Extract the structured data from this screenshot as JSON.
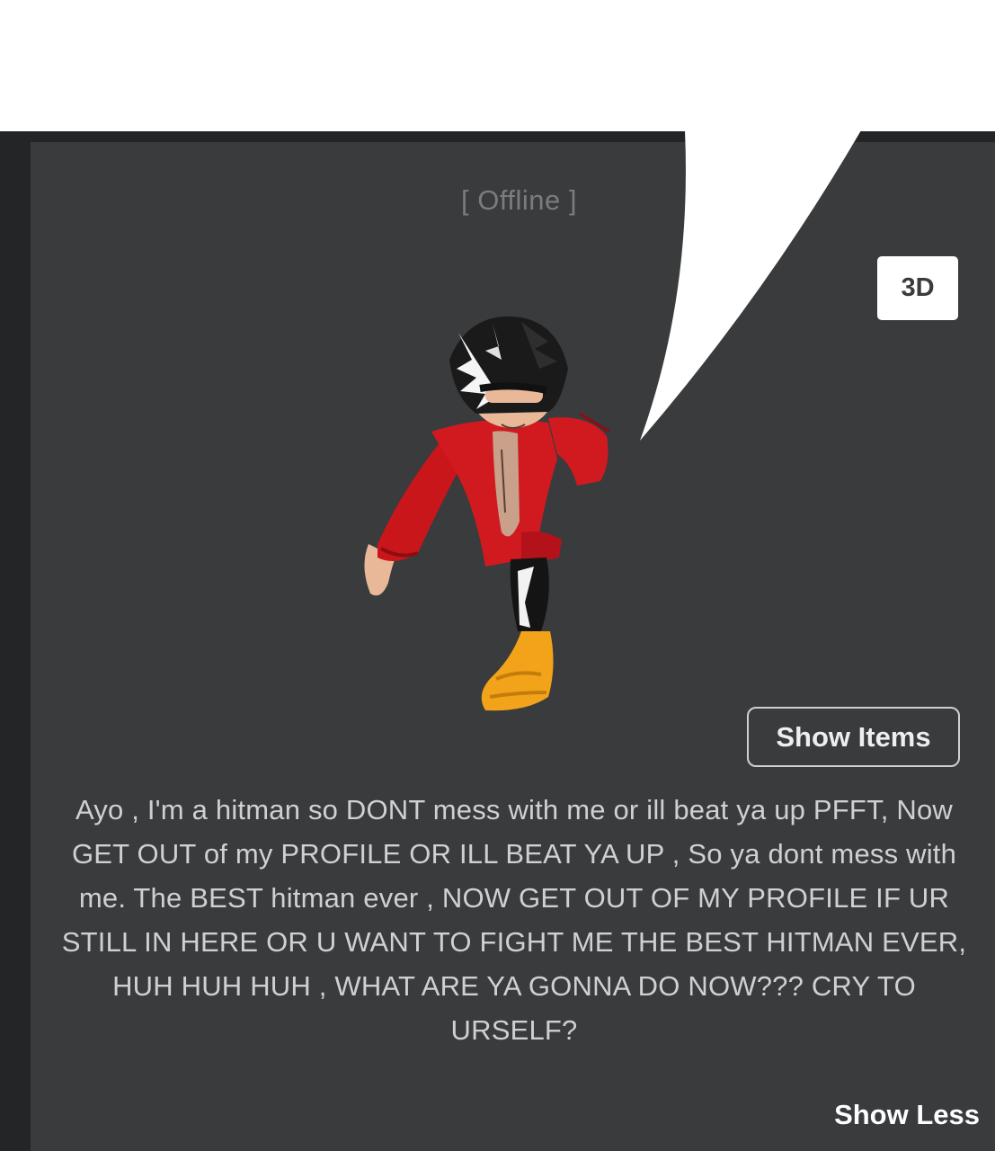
{
  "profile": {
    "status": "[ Offline ]",
    "view_toggle_label": "3D",
    "show_items_label": "Show Items",
    "about_text": "Ayo , I'm a hitman so DONT mess with me or ill beat ya up PFFT, Now GET OUT of my PROFILE OR ILL BEAT YA UP , So ya dont mess with me. The BEST hitman ever , NOW GET OUT OF MY PROFILE IF UR STILL IN HERE OR U WANT TO FIGHT ME THE BEST HITMAN EVER, HUH HUH HUH , WHAT ARE YA GONNA DO NOW??? CRY TO URSELF?",
    "show_less_label": "Show Less"
  },
  "colors": {
    "panel_background": "#393b3d",
    "outer_background": "#232527",
    "text_primary": "#cfd0d2",
    "status_text": "#7a7c7e",
    "avatar_shirt": "#c8161b",
    "avatar_shoes": "#f2a31a",
    "avatar_hair": "#1a1a1a",
    "avatar_skin": "#e8b899"
  },
  "icons": {
    "avatar": "avatar-3d-render",
    "speech_bubble": "speech-bubble-tail"
  }
}
